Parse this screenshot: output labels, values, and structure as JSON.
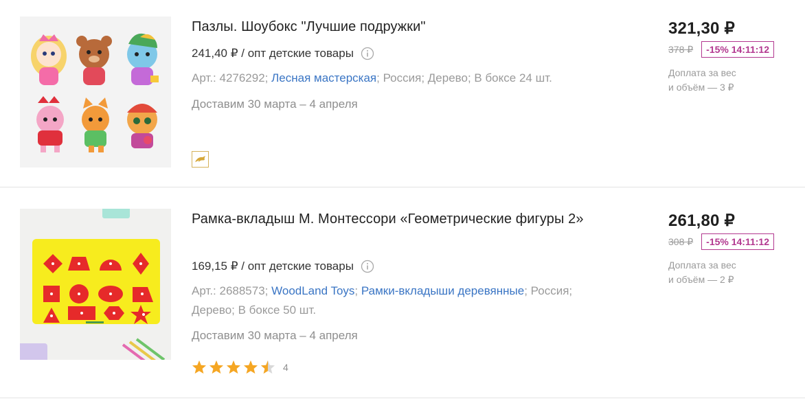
{
  "products": [
    {
      "title": "Пазлы. Шоубокс \"Лучшие подружки\"",
      "wholesale": "241,40 ₽ / опт детские товары",
      "meta_prefix": "Арт.: 4276292; ",
      "link1": "Лесная мастерская",
      "meta_suffix": "; Россия; Дерево; В боксе 24 шт.",
      "delivery": "Доставим 30 марта – 4 апреля",
      "badge_icon": "dolphin-icon",
      "price": "321,30 ₽",
      "old_price": "378 ₽",
      "discount": "-15% 14:11:12",
      "extra_line1": "Доплата за вес",
      "extra_line2": "и объём — 3 ₽"
    },
    {
      "title": "Рамка-вкладыш М. Монтессори «Геометрические фигуры 2»",
      "wholesale": "169,15 ₽ / опт детские товары",
      "meta_prefix": "Арт.: 2688573; ",
      "link1": "WoodLand Toys",
      "sep": "; ",
      "link2": "Рамки-вкладыши деревянные",
      "meta_suffix": "; Россия; Дерево; В боксе 50 шт.",
      "delivery": "Доставим 30 марта – 4 апреля",
      "rating": 4.5,
      "rating_count": "4",
      "price": "261,80 ₽",
      "old_price": "308 ₽",
      "discount": "-15% 14:11:12",
      "extra_line1": "Доплата за вес",
      "extra_line2": "и объём — 2 ₽"
    }
  ],
  "colors": {
    "link": "#3a75c4",
    "discount": "#b2378f",
    "star": "#f5a623",
    "badge_border": "#d6b25b"
  }
}
